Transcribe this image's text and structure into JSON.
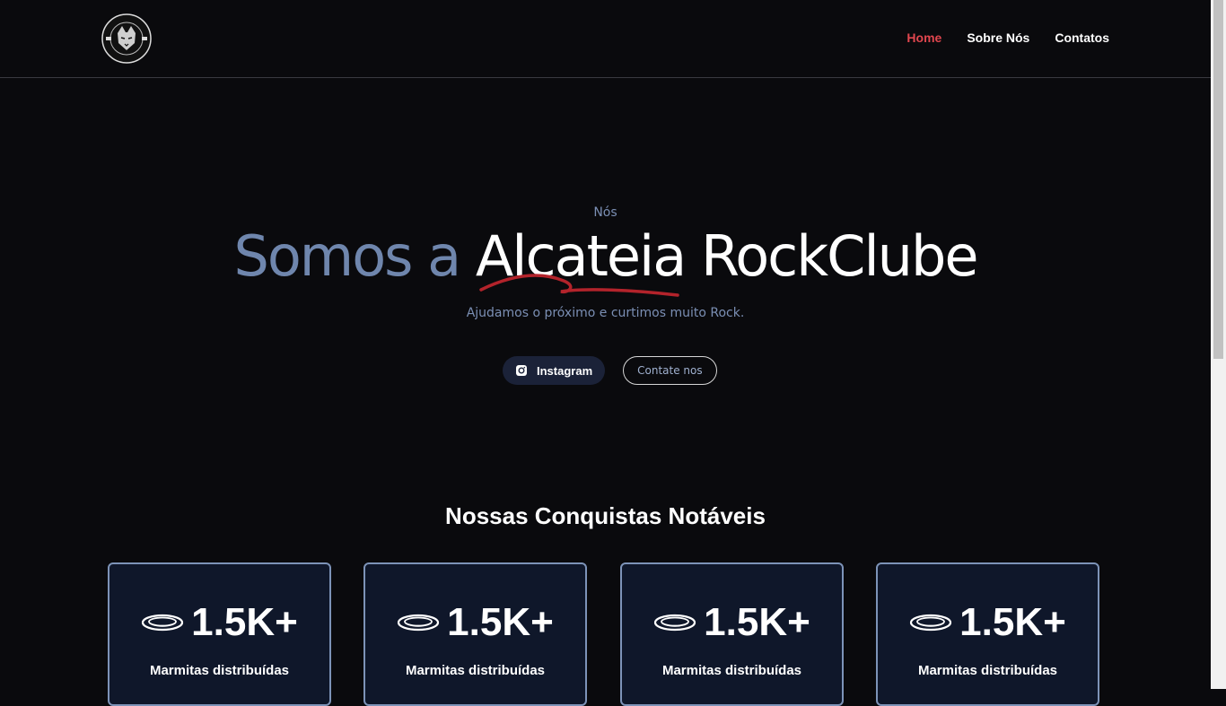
{
  "header": {
    "logo_alt": "ALCATEIA ROCKCLUBE",
    "nav": [
      {
        "label": "Home",
        "active": true
      },
      {
        "label": "Sobre Nós",
        "active": false
      },
      {
        "label": "Contatos",
        "active": false
      }
    ]
  },
  "hero": {
    "eyebrow": "Nós",
    "title_part1": "Somos a ",
    "title_part2": "Alcateia RockClube",
    "subtitle": "Ajudamos o próximo e curtimos muito Rock.",
    "instagram_label": "Instagram",
    "contact_label": "Contate nos"
  },
  "achievements": {
    "title": "Nossas Conquistas Notáveis",
    "cards": [
      {
        "icon": "plate-icon",
        "value": "1.5K+",
        "label": "Marmitas distribuídas"
      },
      {
        "icon": "plate-icon",
        "value": "1.5K+",
        "label": "Marmitas distribuídas"
      },
      {
        "icon": "plate-icon",
        "value": "1.5K+",
        "label": "Marmitas distribuídas"
      },
      {
        "icon": "plate-icon",
        "value": "1.5K+",
        "label": "Marmitas distribuídas"
      }
    ]
  },
  "colors": {
    "accent_red": "#e0464e",
    "muted_blue": "#6f86ad",
    "card_bg": "#0f172a",
    "card_border": "#7d93b8"
  }
}
